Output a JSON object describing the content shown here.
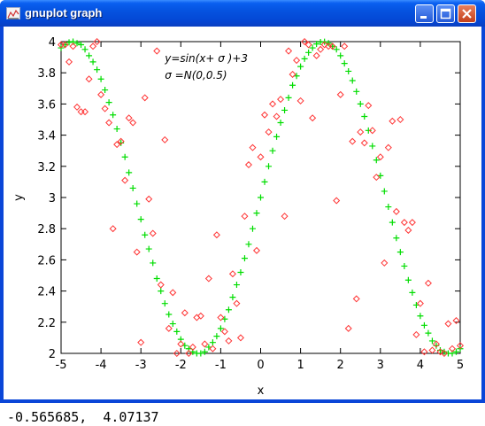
{
  "window": {
    "title": "gnuplot graph",
    "icon": "gnuplot-app-icon",
    "buttons": [
      "minimize",
      "maximize",
      "close"
    ]
  },
  "status_bar": {
    "coordinates": "-0.565685,  4.07137"
  },
  "colors": {
    "data_points": "#ff3333",
    "fit_points": "#00dd00",
    "axes": "#000000",
    "titlebar": "#0a5ff0"
  },
  "chart_data": {
    "type": "scatter",
    "xlabel": "x",
    "ylabel": "y",
    "xlim": [
      -5,
      5
    ],
    "ylim": [
      2,
      4
    ],
    "xticks": [
      "-5",
      "-4",
      "-3",
      "-2",
      "-1",
      "0",
      "1",
      "2",
      "3",
      "4",
      "5"
    ],
    "yticks": [
      "2",
      "2.2",
      "2.4",
      "2.6",
      "2.8",
      "3",
      "3.2",
      "3.4",
      "3.6",
      "3.8",
      "4"
    ],
    "annotations": [
      "y=sin(x+ σ )+3",
      "σ =N(0,0.5)"
    ],
    "grid": false,
    "series": [
      {
        "marker": "plus",
        "color": "#00dd00",
        "points": [
          [
            -5.0,
            3.96
          ],
          [
            -4.9,
            3.98
          ],
          [
            -4.8,
            3.995
          ],
          [
            -4.7,
            4.0
          ],
          [
            -4.6,
            3.99
          ],
          [
            -4.5,
            3.98
          ],
          [
            -4.4,
            3.95
          ],
          [
            -4.3,
            3.91
          ],
          [
            -4.2,
            3.87
          ],
          [
            -4.1,
            3.82
          ],
          [
            -4.0,
            3.76
          ],
          [
            -3.9,
            3.69
          ],
          [
            -3.8,
            3.61
          ],
          [
            -3.7,
            3.53
          ],
          [
            -3.6,
            3.44
          ],
          [
            -3.5,
            3.35
          ],
          [
            -3.4,
            3.26
          ],
          [
            -3.3,
            3.16
          ],
          [
            -3.2,
            3.06
          ],
          [
            -3.1,
            2.96
          ],
          [
            -3.0,
            2.86
          ],
          [
            -2.9,
            2.76
          ],
          [
            -2.8,
            2.67
          ],
          [
            -2.7,
            2.58
          ],
          [
            -2.6,
            2.48
          ],
          [
            -2.5,
            2.4
          ],
          [
            -2.4,
            2.32
          ],
          [
            -2.3,
            2.25
          ],
          [
            -2.2,
            2.19
          ],
          [
            -2.1,
            2.14
          ],
          [
            -2.0,
            2.09
          ],
          [
            -1.9,
            2.05
          ],
          [
            -1.8,
            2.03
          ],
          [
            -1.7,
            2.01
          ],
          [
            -1.6,
            2.0
          ],
          [
            -1.5,
            2.0
          ],
          [
            -1.4,
            2.01
          ],
          [
            -1.3,
            2.04
          ],
          [
            -1.2,
            2.07
          ],
          [
            -1.1,
            2.11
          ],
          [
            -1.0,
            2.16
          ],
          [
            -0.9,
            2.22
          ],
          [
            -0.8,
            2.28
          ],
          [
            -0.7,
            2.36
          ],
          [
            -0.6,
            2.44
          ],
          [
            -0.5,
            2.52
          ],
          [
            -0.4,
            2.61
          ],
          [
            -0.3,
            2.7
          ],
          [
            -0.2,
            2.8
          ],
          [
            -0.1,
            2.9
          ],
          [
            0.0,
            3.0
          ],
          [
            0.1,
            3.1
          ],
          [
            0.2,
            3.2
          ],
          [
            0.3,
            3.3
          ],
          [
            0.4,
            3.39
          ],
          [
            0.5,
            3.48
          ],
          [
            0.6,
            3.56
          ],
          [
            0.7,
            3.64
          ],
          [
            0.8,
            3.72
          ],
          [
            0.9,
            3.78
          ],
          [
            1.0,
            3.84
          ],
          [
            1.1,
            3.89
          ],
          [
            1.2,
            3.93
          ],
          [
            1.3,
            3.96
          ],
          [
            1.4,
            3.985
          ],
          [
            1.5,
            3.997
          ],
          [
            1.6,
            3.999
          ],
          [
            1.7,
            3.99
          ],
          [
            1.8,
            3.97
          ],
          [
            1.9,
            3.95
          ],
          [
            2.0,
            3.91
          ],
          [
            2.1,
            3.86
          ],
          [
            2.2,
            3.81
          ],
          [
            2.3,
            3.75
          ],
          [
            2.4,
            3.68
          ],
          [
            2.5,
            3.6
          ],
          [
            2.6,
            3.52
          ],
          [
            2.7,
            3.43
          ],
          [
            2.8,
            3.33
          ],
          [
            2.9,
            3.24
          ],
          [
            3.0,
            3.14
          ],
          [
            3.1,
            3.04
          ],
          [
            3.2,
            2.94
          ],
          [
            3.3,
            2.84
          ],
          [
            3.4,
            2.74
          ],
          [
            3.5,
            2.65
          ],
          [
            3.6,
            2.56
          ],
          [
            3.7,
            2.47
          ],
          [
            3.8,
            2.39
          ],
          [
            3.9,
            2.31
          ],
          [
            4.0,
            2.24
          ],
          [
            4.1,
            2.18
          ],
          [
            4.2,
            2.13
          ],
          [
            4.3,
            2.08
          ],
          [
            4.4,
            2.05
          ],
          [
            4.5,
            2.02
          ],
          [
            4.6,
            2.01
          ],
          [
            4.7,
            2.0
          ],
          [
            4.8,
            2.0
          ],
          [
            4.9,
            2.01
          ],
          [
            5.0,
            2.03
          ]
        ]
      },
      {
        "marker": "diamond",
        "color": "#ff3333",
        "points": [
          [
            -5.0,
            3.98
          ],
          [
            -4.9,
            3.98
          ],
          [
            -4.8,
            3.87
          ],
          [
            -4.7,
            3.97
          ],
          [
            -4.6,
            3.58
          ],
          [
            -4.5,
            3.55
          ],
          [
            -4.4,
            3.55
          ],
          [
            -4.3,
            3.76
          ],
          [
            -4.2,
            3.97
          ],
          [
            -4.1,
            4.0
          ],
          [
            -4.0,
            3.66
          ],
          [
            -3.9,
            3.57
          ],
          [
            -3.8,
            3.48
          ],
          [
            -3.7,
            2.8
          ],
          [
            -3.6,
            3.34
          ],
          [
            -3.5,
            3.36
          ],
          [
            -3.4,
            3.11
          ],
          [
            -3.3,
            3.51
          ],
          [
            -3.2,
            3.48
          ],
          [
            -3.1,
            2.65
          ],
          [
            -3.0,
            2.07
          ],
          [
            -2.9,
            3.64
          ],
          [
            -2.8,
            2.99
          ],
          [
            -2.7,
            2.77
          ],
          [
            -2.6,
            3.94
          ],
          [
            -2.5,
            2.44
          ],
          [
            -2.4,
            3.37
          ],
          [
            -2.3,
            2.16
          ],
          [
            -2.2,
            2.39
          ],
          [
            -2.1,
            2.0
          ],
          [
            -2.0,
            2.06
          ],
          [
            -1.9,
            2.26
          ],
          [
            -1.8,
            2.0
          ],
          [
            -1.7,
            2.04
          ],
          [
            -1.6,
            2.23
          ],
          [
            -1.5,
            2.24
          ],
          [
            -1.4,
            2.06
          ],
          [
            -1.3,
            2.48
          ],
          [
            -1.2,
            2.03
          ],
          [
            -1.1,
            2.76
          ],
          [
            -1.0,
            2.23
          ],
          [
            -0.9,
            2.14
          ],
          [
            -0.8,
            2.08
          ],
          [
            -0.7,
            2.51
          ],
          [
            -0.6,
            2.32
          ],
          [
            -0.5,
            2.1
          ],
          [
            -0.4,
            2.88
          ],
          [
            -0.3,
            3.21
          ],
          [
            -0.2,
            3.32
          ],
          [
            -0.1,
            2.66
          ],
          [
            0.0,
            3.26
          ],
          [
            0.1,
            3.53
          ],
          [
            0.2,
            3.42
          ],
          [
            0.3,
            3.6
          ],
          [
            0.4,
            3.52
          ],
          [
            0.5,
            3.63
          ],
          [
            0.6,
            2.88
          ],
          [
            0.7,
            3.94
          ],
          [
            0.8,
            3.79
          ],
          [
            0.9,
            3.88
          ],
          [
            1.0,
            3.62
          ],
          [
            1.1,
            4.0
          ],
          [
            1.2,
            3.98
          ],
          [
            1.3,
            3.51
          ],
          [
            1.4,
            3.91
          ],
          [
            1.5,
            3.95
          ],
          [
            1.6,
            3.98
          ],
          [
            1.7,
            3.97
          ],
          [
            1.8,
            3.97
          ],
          [
            1.9,
            2.98
          ],
          [
            2.0,
            3.66
          ],
          [
            2.1,
            3.97
          ],
          [
            2.2,
            2.16
          ],
          [
            2.3,
            3.36
          ],
          [
            2.4,
            2.35
          ],
          [
            2.5,
            3.42
          ],
          [
            2.6,
            3.35
          ],
          [
            2.7,
            3.59
          ],
          [
            2.8,
            3.43
          ],
          [
            2.9,
            3.13
          ],
          [
            3.0,
            3.26
          ],
          [
            3.1,
            2.58
          ],
          [
            3.2,
            3.32
          ],
          [
            3.3,
            3.49
          ],
          [
            3.4,
            2.91
          ],
          [
            3.5,
            3.5
          ],
          [
            3.6,
            2.84
          ],
          [
            3.7,
            2.79
          ],
          [
            3.8,
            2.84
          ],
          [
            3.9,
            2.12
          ],
          [
            4.0,
            2.32
          ],
          [
            4.1,
            2.01
          ],
          [
            4.2,
            2.45
          ],
          [
            4.3,
            2.02
          ],
          [
            4.4,
            2.06
          ],
          [
            4.5,
            2.01
          ],
          [
            4.6,
            2.0
          ],
          [
            4.7,
            2.19
          ],
          [
            4.8,
            2.03
          ],
          [
            4.9,
            2.21
          ],
          [
            5.0,
            2.05
          ]
        ]
      }
    ]
  }
}
